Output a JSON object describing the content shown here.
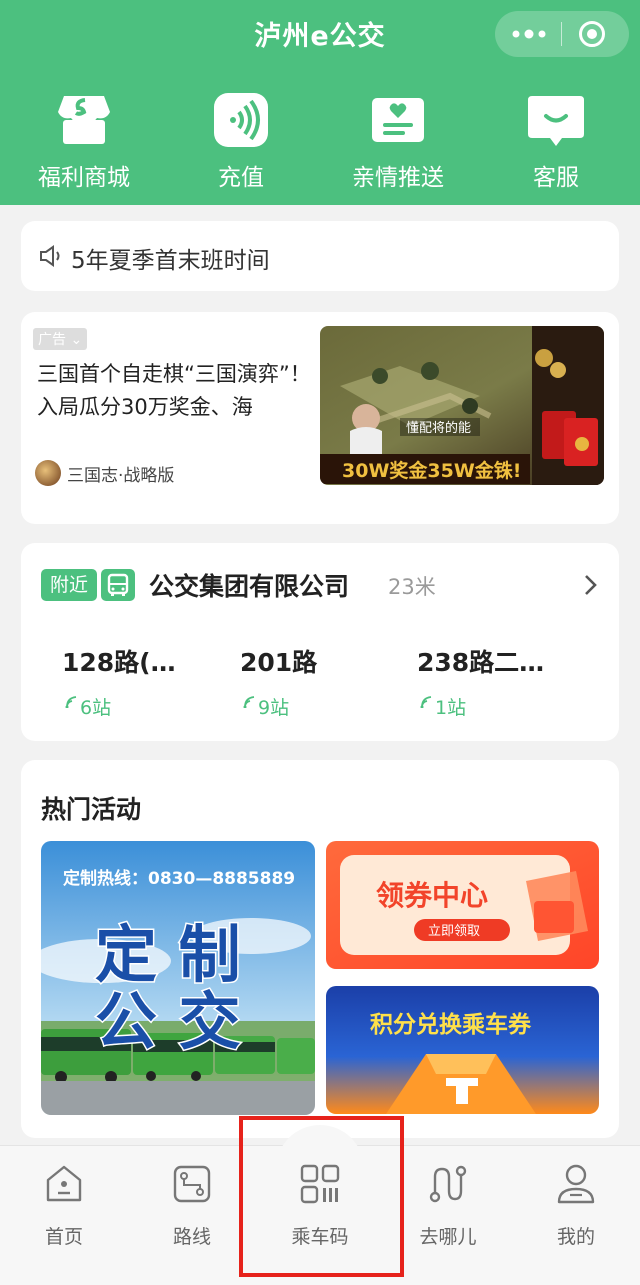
{
  "header": {
    "title": "泸州e公交",
    "capsule": {
      "more_icon": "more-dots-icon",
      "close_icon": "target-circle-icon"
    },
    "background": "#4cc07f"
  },
  "quick_actions": [
    {
      "label": "福利商城",
      "icon": "shop-icon"
    },
    {
      "label": "充值",
      "icon": "nfc-icon"
    },
    {
      "label": "亲情推送",
      "icon": "heart-card-icon"
    },
    {
      "label": "客服",
      "icon": "chat-icon"
    }
  ],
  "notice": {
    "text": "5年夏季首末班时间",
    "icon": "speaker-icon"
  },
  "ad": {
    "tag": "广告",
    "title": "三国首个自走棋“三国演弈”！入局瓜分30万奖金、海",
    "brand": "三国志·战略版",
    "image_caption": "懂配将的能",
    "image_promo": "30W奖金35W金铢!"
  },
  "nearby": {
    "tag": "附近",
    "stop_name": "公交集团有限公司",
    "distance": "23米",
    "routes": [
      {
        "name": "128路(…",
        "stops": "6站"
      },
      {
        "name": "201路",
        "stops": "9站"
      },
      {
        "name": "238路二…",
        "stops": "1站"
      }
    ]
  },
  "hot": {
    "title": "热门活动",
    "banners": [
      {
        "hotline": "定制热线：0830—8885889",
        "line1": "定 制",
        "line2": "公 交"
      },
      {
        "title": "领券中心",
        "button": "立即领取"
      },
      {
        "title": "积分兑换乘车券"
      }
    ]
  },
  "tabbar": [
    {
      "label": "首页",
      "icon": "home-icon"
    },
    {
      "label": "路线",
      "icon": "route-icon"
    },
    {
      "label": "乘车码",
      "icon": "qr-code-icon"
    },
    {
      "label": "去哪儿",
      "icon": "path-icon"
    },
    {
      "label": "我的",
      "icon": "user-icon"
    }
  ],
  "colors": {
    "accent": "#4cc07f",
    "highlight_border": "#e6221b"
  }
}
